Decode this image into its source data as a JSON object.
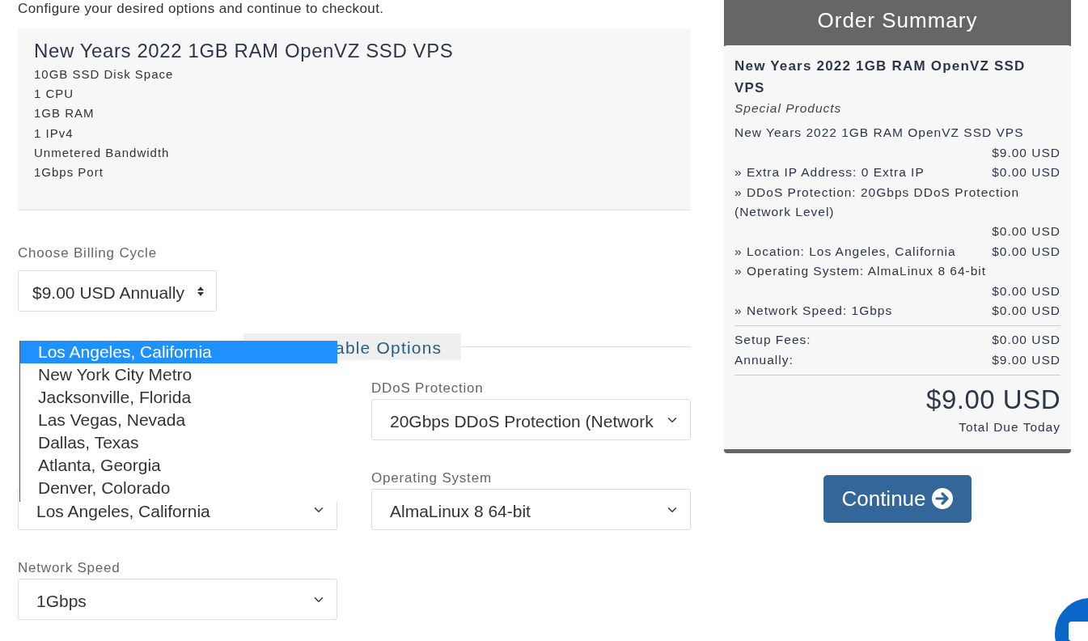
{
  "intro": "Configure your desired options and continue to checkout.",
  "product": {
    "name": "New Years 2022 1GB RAM OpenVZ SSD VPS",
    "features": [
      "10GB SSD Disk Space",
      "1 CPU",
      "1GB RAM",
      "1 IPv4",
      "Unmetered Bandwidth",
      "1Gbps Port"
    ]
  },
  "billing_cycle": {
    "label": "Choose Billing Cycle",
    "value": "$9.00 USD Annually"
  },
  "configurable_options": {
    "heading": "able Options",
    "options": [
      {
        "kind": "hidden"
      },
      {
        "kind": "select",
        "label": "DDoS Protection",
        "value": "20Gbps DDoS Protection (Network"
      },
      {
        "kind": "select",
        "value": "Los Angeles, California"
      },
      {
        "kind": "select",
        "label": "Operating System",
        "value": "AlmaLinux 8 64-bit"
      },
      {
        "kind": "select",
        "label": "Network Speed",
        "value": "1Gbps"
      }
    ]
  },
  "location_dropdown": {
    "items": [
      {
        "text": "Los Angeles, California",
        "selected": true
      },
      {
        "text": "New York City Metro",
        "selected": false
      },
      {
        "text": "Jacksonville, Florida",
        "selected": false
      },
      {
        "text": "Las Vegas, Nevada",
        "selected": false
      },
      {
        "text": "Dallas, Texas",
        "selected": false
      },
      {
        "text": "Atlanta, Georgia",
        "selected": false
      },
      {
        "text": "Denver, Colorado",
        "selected": false
      }
    ]
  },
  "order_summary": {
    "title": "Order Summary",
    "product_name": "New Years 2022 1GB RAM OpenVZ SSD VPS",
    "group": "Special Products",
    "lines": [
      {
        "text": "New Years 2022 1GB RAM OpenVZ SSD VPS",
        "price": "$9.00 USD"
      },
      {
        "text": "» Extra IP Address: 0 Extra IP",
        "price": "$0.00 USD"
      },
      {
        "text": "» DDoS Protection: 20Gbps DDoS Protection (Network Level)",
        "price": "$0.00 USD"
      },
      {
        "text": "» Location: Los Angeles, California",
        "price": "$0.00 USD"
      },
      {
        "text": "» Operating System: AlmaLinux 8 64-bit",
        "price": "$0.00 USD"
      },
      {
        "text": "» Network Speed: 1Gbps",
        "price": "$0.00 USD"
      }
    ],
    "totals": [
      {
        "label": "Setup Fees:",
        "value": "$0.00 USD"
      },
      {
        "label": "Annually:",
        "value": "$9.00 USD"
      }
    ],
    "total": "$9.00 USD",
    "total_label": "Total Due Today"
  },
  "continue_button": "Continue"
}
